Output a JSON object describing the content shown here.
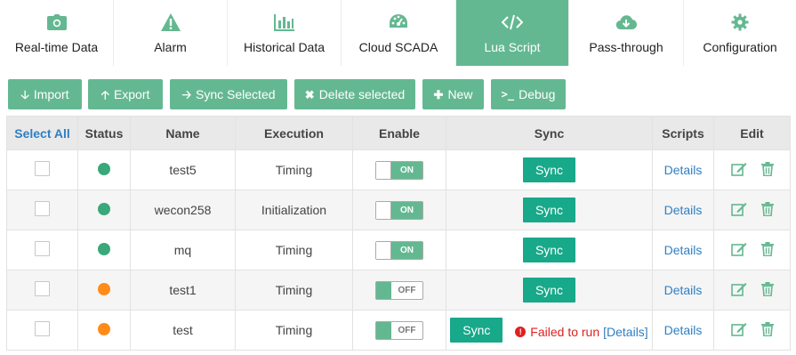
{
  "nav": {
    "tabs": [
      {
        "label": "Real-time Data",
        "icon": "camera-icon"
      },
      {
        "label": "Alarm",
        "icon": "warning-icon"
      },
      {
        "label": "Historical Data",
        "icon": "bar-chart-icon"
      },
      {
        "label": "Cloud SCADA",
        "icon": "dashboard-icon"
      },
      {
        "label": "Lua Script",
        "icon": "code-icon"
      },
      {
        "label": "Pass-through",
        "icon": "cloud-download-icon"
      },
      {
        "label": "Configuration",
        "icon": "gear-icon"
      }
    ],
    "active": "Lua Script"
  },
  "toolbar": {
    "import": "Import",
    "export": "Export",
    "sync_selected": "Sync Selected",
    "delete_selected": "Delete selected",
    "new": "New",
    "debug": "Debug"
  },
  "table": {
    "headers": {
      "select_all": "Select All",
      "status": "Status",
      "name": "Name",
      "execution": "Execution",
      "enable": "Enable",
      "sync": "Sync",
      "scripts": "Scripts",
      "edit": "Edit"
    },
    "rows": [
      {
        "name": "test5",
        "execution": "Timing",
        "status_color": "#3aa87a",
        "enable": "ON",
        "sync_label": "Sync",
        "details": "Details"
      },
      {
        "name": "wecon258",
        "execution": "Initialization",
        "status_color": "#3aa87a",
        "enable": "ON",
        "sync_label": "Sync",
        "details": "Details"
      },
      {
        "name": "mq",
        "execution": "Timing",
        "status_color": "#3aa87a",
        "enable": "ON",
        "sync_label": "Sync",
        "details": "Details"
      },
      {
        "name": "test1",
        "execution": "Timing",
        "status_color": "#ff8c1a",
        "enable": "OFF",
        "sync_label": "Sync",
        "details": "Details"
      },
      {
        "name": "test",
        "execution": "Timing",
        "status_color": "#ff8c1a",
        "enable": "OFF",
        "sync_label": "Sync",
        "details": "Details",
        "error": "Failed to run",
        "error_link": "[Details]"
      }
    ]
  },
  "colors": {
    "accent": "#64b891",
    "sync_button": "#18a88a",
    "link": "#2f7fc1",
    "error": "#e02020",
    "status_ok": "#3aa87a",
    "status_warn": "#ff8c1a"
  }
}
